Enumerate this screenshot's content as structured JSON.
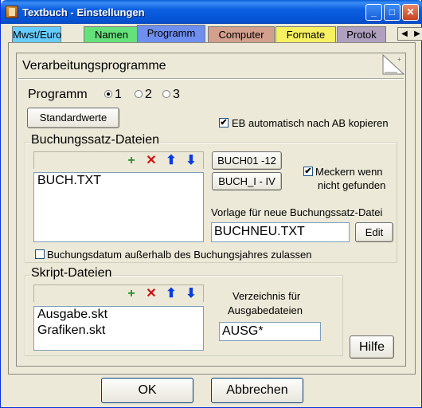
{
  "window": {
    "title": "Textbuch - Einstellungen",
    "minimize": "_",
    "maximize": "□",
    "close": "✕"
  },
  "tabs": [
    {
      "label": "Mwst/Euro",
      "color": "#66ccff"
    },
    {
      "label": "Namen",
      "color": "#66e07a"
    },
    {
      "label": "Programm",
      "color": "#6e8ff0",
      "active": true
    },
    {
      "label": "Computer",
      "color": "#d2a08c"
    },
    {
      "label": "Formate",
      "color": "#f7f060"
    },
    {
      "label": "Protok",
      "color": "#b0a0c0"
    }
  ],
  "tab_scroll": {
    "left": "◀",
    "right": "▶"
  },
  "section": {
    "title": "Verarbeitungsprogramme"
  },
  "programm": {
    "label": "Programm",
    "options": [
      "1",
      "2",
      "3"
    ],
    "selected": "1"
  },
  "standardwerte_label": "Standardwerte",
  "eb_checkbox": {
    "label": "EB automatisch nach AB kopieren",
    "checked": true,
    "mark": "✔"
  },
  "buchungssatz": {
    "title": "Buchungssatz-Dateien",
    "files": [
      "BUCH.TXT"
    ],
    "buch01_label": "BUCH01 -12",
    "buchi_label": "BUCH_I - IV",
    "meckern_label_1": "Meckern wenn",
    "meckern_label_2": "nicht gefunden",
    "meckern_checked": true,
    "vorlage_label": "Vorlage für neue Buchungssatz-Datei",
    "vorlage_value": "BUCHNEU.TXT",
    "edit_label": "Edit",
    "datum_label": "Buchungsdatum außerhalb des Buchungsjahres zulassen",
    "datum_checked": false
  },
  "skript": {
    "title": "Skript-Dateien",
    "files": [
      "Ausgabe.skt",
      "Grafiken.skt"
    ],
    "verzeichnis_label_1": "Verzeichnis für",
    "verzeichnis_label_2": "Ausgabedateien",
    "verzeichnis_value": "AUSG*"
  },
  "tools": {
    "new": "+",
    "delete": "✕",
    "up": "⬆",
    "down": "⬇"
  },
  "hilfe_label": "Hilfe",
  "ok_label": "OK",
  "abbrechen_label": "Abbrechen"
}
